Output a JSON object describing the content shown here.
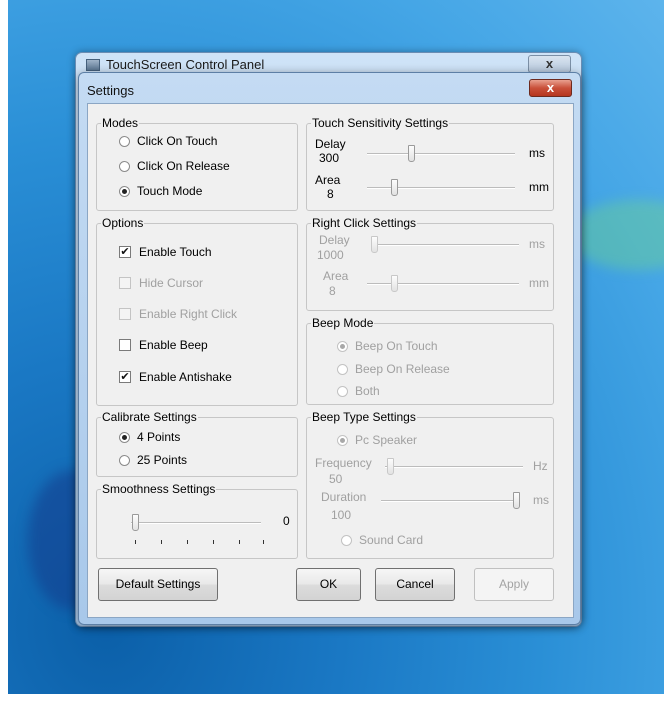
{
  "window_behind": {
    "title": "TouchScreen Control Panel",
    "close_glyph": "x"
  },
  "dialog": {
    "title": "Settings",
    "close_glyph": "x"
  },
  "modes": {
    "title": "Modes",
    "options": [
      "Click On Touch",
      "Click On Release",
      "Touch Mode"
    ],
    "selected": "Touch Mode"
  },
  "touch_sensitivity": {
    "title": "Touch Sensitivity Settings",
    "delay": {
      "label": "Delay",
      "value": "300",
      "unit": "ms"
    },
    "area": {
      "label": "Area",
      "value": "8",
      "unit": "mm"
    }
  },
  "options": {
    "title": "Options",
    "items": [
      {
        "label": "Enable Touch",
        "checked": true,
        "enabled": true
      },
      {
        "label": "Hide Cursor",
        "checked": false,
        "enabled": false
      },
      {
        "label": "Enable Right Click",
        "checked": false,
        "enabled": false
      },
      {
        "label": "Enable Beep",
        "checked": false,
        "enabled": true
      },
      {
        "label": "Enable Antishake",
        "checked": true,
        "enabled": true
      }
    ]
  },
  "right_click": {
    "title": "Right Click Settings",
    "delay": {
      "label": "Delay",
      "value": "1000",
      "unit": "ms"
    },
    "area": {
      "label": "Area",
      "value": "8",
      "unit": "mm"
    }
  },
  "beep_mode": {
    "title": "Beep Mode",
    "options": [
      "Beep On Touch",
      "Beep On Release",
      "Both"
    ],
    "selected": "Beep On Touch"
  },
  "calibrate": {
    "title": "Calibrate Settings",
    "options": [
      "4 Points",
      "25 Points"
    ],
    "selected": "4 Points"
  },
  "beep_type": {
    "title": "Beep Type Settings",
    "pc_speaker": "Pc Speaker",
    "frequency": {
      "label": "Frequency",
      "value": "50",
      "unit": "Hz"
    },
    "duration": {
      "label": "Duration",
      "value": "100",
      "unit": "ms"
    },
    "sound_card": "Sound Card"
  },
  "smoothness": {
    "title": "Smoothness Settings",
    "value": "0"
  },
  "buttons": {
    "default": "Default Settings",
    "ok": "OK",
    "cancel": "Cancel",
    "apply": "Apply"
  },
  "check_glyph": "✔"
}
